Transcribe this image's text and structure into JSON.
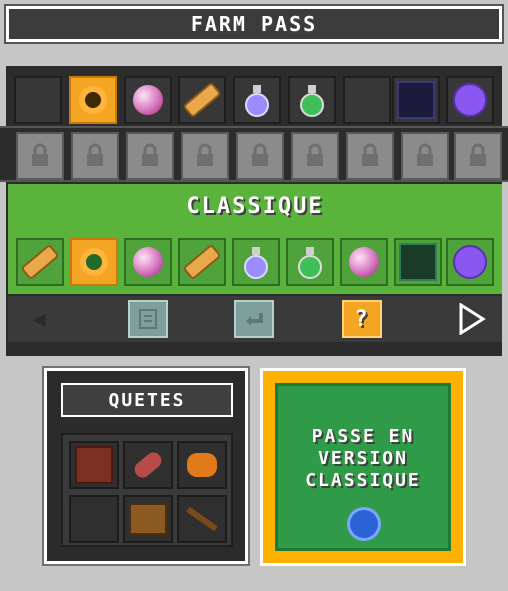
{
  "header": {
    "title": "FARM PASS"
  },
  "top_row": [
    {
      "icon": "empty-slot"
    },
    {
      "icon": "ring-icon"
    },
    {
      "icon": "pearl-icon"
    },
    {
      "icon": "scroll-icon"
    },
    {
      "icon": "potion-purple-icon"
    },
    {
      "icon": "potion-green-icon"
    },
    {
      "icon": "empty-slot"
    },
    {
      "icon": "cube-icon"
    },
    {
      "icon": "orb-icon"
    }
  ],
  "locked_row_count": 9,
  "classique": {
    "label": "CLASSIQUE",
    "rewards": [
      {
        "icon": "scroll-icon"
      },
      {
        "icon": "ring-icon"
      },
      {
        "icon": "pearl-icon"
      },
      {
        "icon": "scroll-icon"
      },
      {
        "icon": "potion-purple-icon"
      },
      {
        "icon": "potion-green-icon"
      },
      {
        "icon": "pearl-icon"
      },
      {
        "icon": "cube-icon"
      },
      {
        "icon": "orb-icon"
      }
    ]
  },
  "nav": {
    "prev": "◀",
    "next": "▷",
    "help": "?"
  },
  "quests": {
    "title": "QUETES",
    "items": [
      {
        "icon": "wood-block-icon"
      },
      {
        "icon": "meat-icon"
      },
      {
        "icon": "fruit-icon"
      },
      {
        "icon": "dark-egg-icon"
      },
      {
        "icon": "chest-icon"
      },
      {
        "icon": "crossbow-icon"
      }
    ]
  },
  "upgrade": {
    "text": "PASSE EN VERSION CLASSIQUE"
  },
  "colors": {
    "accent_green": "#5ab33a",
    "gold": "#ffb100",
    "dark_green": "#2f9a47"
  }
}
